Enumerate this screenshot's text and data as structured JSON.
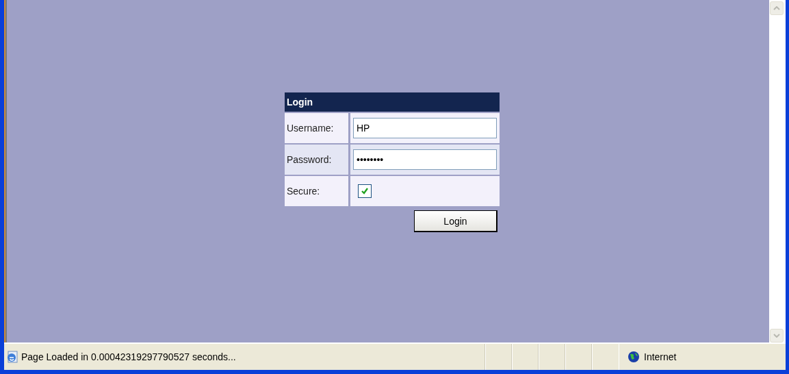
{
  "login_form": {
    "title": "Login",
    "fields": [
      {
        "kind": "text",
        "label": "Username:",
        "value": "HP"
      },
      {
        "kind": "text",
        "label": "Password:",
        "value": "••••••••"
      },
      {
        "kind": "checkbox",
        "label": "Secure:",
        "checked": true
      }
    ],
    "submit_button": "Login"
  },
  "status_bar": {
    "message": "Page Loaded in 0.00042319297790527 seconds...",
    "zone": "Internet"
  }
}
